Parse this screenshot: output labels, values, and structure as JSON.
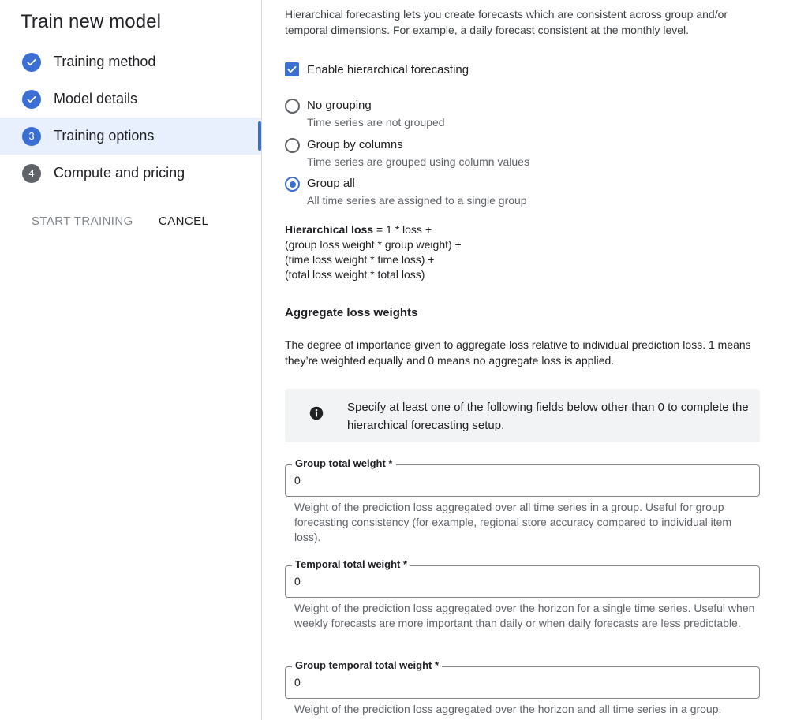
{
  "sidebar": {
    "title": "Train new model",
    "steps": [
      {
        "label": "Training method",
        "state": "done"
      },
      {
        "label": "Model details",
        "state": "done"
      },
      {
        "label": "Training options",
        "state": "current",
        "number": "3"
      },
      {
        "label": "Compute and pricing",
        "state": "pending",
        "number": "4"
      }
    ],
    "start_training_label": "START TRAINING",
    "cancel_label": "CANCEL"
  },
  "main": {
    "intro": "Hierarchical forecasting lets you create forecasts which are consistent across group and/or temporal dimensions. For example, a daily forecast consistent at the monthly level.",
    "enable_checkbox": {
      "label": "Enable hierarchical forecasting",
      "checked": true
    },
    "grouping_options": [
      {
        "title": "No grouping",
        "description": "Time series are not grouped",
        "selected": false
      },
      {
        "title": "Group by columns",
        "description": "Time series are grouped using column values",
        "selected": false
      },
      {
        "title": "Group all",
        "description": "All time series are assigned to a single group",
        "selected": true
      }
    ],
    "formula": {
      "label": "Hierarchical loss",
      "line1": " = 1 * loss +",
      "line2": "(group loss weight * group weight) +",
      "line3": "(time loss weight * time loss) +",
      "line4": "(total loss weight * total loss)"
    },
    "aggregate_title": "Aggregate loss weights",
    "aggregate_description": "The degree of importance given to aggregate loss relative to individual prediction loss. 1 means they’re weighted equally and 0 means no aggregate loss is applied.",
    "info_message": "Specify at least one of the following fields below other than 0 to complete the hierarchical forecasting setup.",
    "fields": [
      {
        "label": "Group total weight *",
        "value": "0",
        "help": "Weight of the prediction loss aggregated over all time series in a group. Useful for group forecasting consistency (for example, regional store accuracy compared to individual item loss)."
      },
      {
        "label": "Temporal total weight *",
        "value": "0",
        "help": "Weight of the prediction loss aggregated over the horizon for a single time series. Useful when weekly forecasts are more important than daily or when daily forecasts are less predictable."
      },
      {
        "label": "Group temporal total weight *",
        "value": "0",
        "help": "Weight of the prediction loss aggregated over the horizon and all time series in a group."
      }
    ]
  },
  "colors": {
    "accent": "#3b6fd4",
    "active_bg": "#e8f0fe",
    "pending": "#5f6368",
    "info_bg": "#f1f3f4"
  },
  "icons": [
    "check-icon",
    "info-icon"
  ]
}
